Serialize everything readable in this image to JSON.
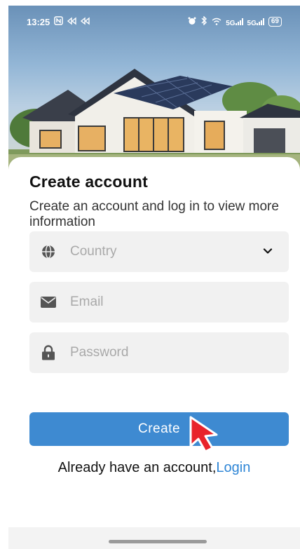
{
  "status_bar": {
    "time": "13:25",
    "left_icons": [
      "nfc-icon",
      "vpn-icon",
      "vpn-icon"
    ],
    "right_icons": [
      "alarm-icon",
      "bluetooth-icon",
      "wifi-icon",
      "signal-5g-icon",
      "signal-5g-icon"
    ],
    "signal_label": "5G",
    "battery": "69"
  },
  "header": {
    "title": "Create account",
    "subtitle": "Create an account and log in to view more information"
  },
  "form": {
    "country_placeholder": "Country",
    "email_placeholder": "Email",
    "password_placeholder": "Password"
  },
  "actions": {
    "create_label": "Create",
    "login_prompt": "Already have an account,",
    "login_link": "Login"
  },
  "colors": {
    "primary": "#3e8ad1",
    "link": "#2f86d6",
    "field_bg": "#f1f1f1",
    "cursor": "#e8232b"
  }
}
